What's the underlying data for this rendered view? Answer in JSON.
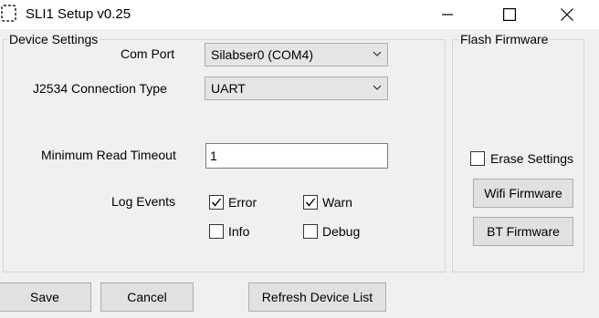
{
  "window": {
    "title": "SLI1 Setup v0.25"
  },
  "device_settings": {
    "title": "Device Settings",
    "com_port": {
      "label": "Com Port",
      "value": "Silabser0 (COM4)"
    },
    "connection_type": {
      "label": "J2534 Connection Type",
      "value": "UART"
    },
    "min_read_timeout": {
      "label": "Minimum Read Timeout",
      "value": "1"
    },
    "log_events": {
      "label": "Log Events",
      "error": {
        "label": "Error",
        "checked": true
      },
      "warn": {
        "label": "Warn",
        "checked": true
      },
      "info": {
        "label": "Info",
        "checked": false
      },
      "debug": {
        "label": "Debug",
        "checked": false
      }
    }
  },
  "flash_firmware": {
    "title": "Flash Firmware",
    "erase_settings": {
      "label": "Erase Settings",
      "checked": false
    },
    "wifi_button": "Wifi Firmware",
    "bt_button": "BT Firmware"
  },
  "buttons": {
    "save": "Save",
    "cancel": "Cancel",
    "refresh": "Refresh Device List"
  }
}
